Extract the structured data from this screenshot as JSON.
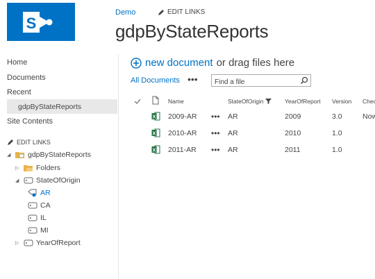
{
  "header": {
    "site_link": "Demo",
    "edit_links": "EDIT LINKS",
    "title": "gdpByStateReports"
  },
  "nav": {
    "items": [
      "Home",
      "Documents",
      "Recent"
    ],
    "recent_sub": "gdpByStateReports",
    "site_contents": "Site Contents",
    "edit_links": "EDIT LINKS"
  },
  "tree": {
    "root": "gdpByStateReports",
    "folders": "Folders",
    "state_of_origin": "StateOfOrigin",
    "states": [
      "AR",
      "CA",
      "IL",
      "MI"
    ],
    "selected_state": "AR",
    "year_of_report": "YearOfReport"
  },
  "toolbar": {
    "new_document": "new document",
    "drag_text": "or drag files here",
    "view": "All Documents",
    "more": "•••",
    "search_placeholder": "Find a file"
  },
  "table": {
    "columns": [
      "Name",
      "StateOfOrigin",
      "YearOfReport",
      "Version",
      "Chec"
    ],
    "rows": [
      {
        "name": "2009-AR",
        "state": "AR",
        "year": "2009",
        "version": "3.0",
        "checked": "Now"
      },
      {
        "name": "2010-AR",
        "state": "AR",
        "year": "2010",
        "version": "1.0",
        "checked": ""
      },
      {
        "name": "2011-AR",
        "state": "AR",
        "year": "2011",
        "version": "1.0",
        "checked": ""
      }
    ],
    "row_menu": "•••"
  },
  "colors": {
    "brand": "#0072c6",
    "excel": "#217346",
    "folder": "#e8b448"
  }
}
